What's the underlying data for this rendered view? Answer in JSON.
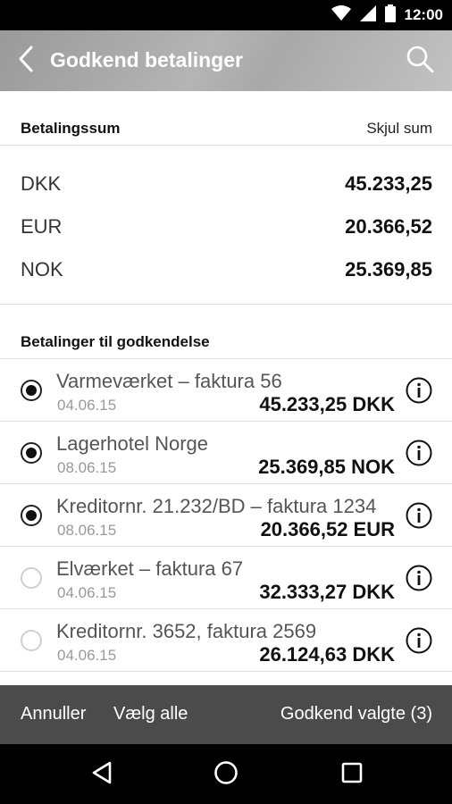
{
  "status_bar": {
    "time": "12:00"
  },
  "app_bar": {
    "title": "Godkend betalinger"
  },
  "sum_section": {
    "header": "Betalingssum",
    "hide_label": "Skjul sum",
    "rows": [
      {
        "currency": "DKK",
        "amount": "45.233,25"
      },
      {
        "currency": "EUR",
        "amount": "20.366,52"
      },
      {
        "currency": "NOK",
        "amount": "25.369,85"
      }
    ]
  },
  "payments_section": {
    "header": "Betalinger til godkendelse",
    "items": [
      {
        "name": "Varmeværket – faktura 56",
        "date": "04.06.15",
        "amount": "45.233,25 DKK",
        "selected": true
      },
      {
        "name": "Lagerhotel Norge",
        "date": "08.06.15",
        "amount": "25.369,85 NOK",
        "selected": true
      },
      {
        "name": "Kreditornr. 21.232/BD – faktura 1234",
        "date": "08.06.15",
        "amount": "20.366,52 EUR",
        "selected": true
      },
      {
        "name": "Elværket – faktura 67",
        "date": "04.06.15",
        "amount": "32.333,27 DKK",
        "selected": false
      },
      {
        "name": "Kreditornr. 3652, faktura 2569",
        "date": "04.06.15",
        "amount": "26.124,63 DKK",
        "selected": false
      }
    ]
  },
  "action_bar": {
    "cancel_label": "Annuller",
    "select_all_label": "Vælg alle",
    "approve_label": "Godkend valgte (3)"
  },
  "icons": {
    "back": "chevron-left-icon",
    "search": "search-icon",
    "info": "info-icon",
    "wifi": "wifi-icon",
    "signal": "signal-icon",
    "battery": "battery-icon",
    "nav_back": "triangle-back-icon",
    "nav_home": "circle-home-icon",
    "nav_recents": "square-recents-icon"
  }
}
